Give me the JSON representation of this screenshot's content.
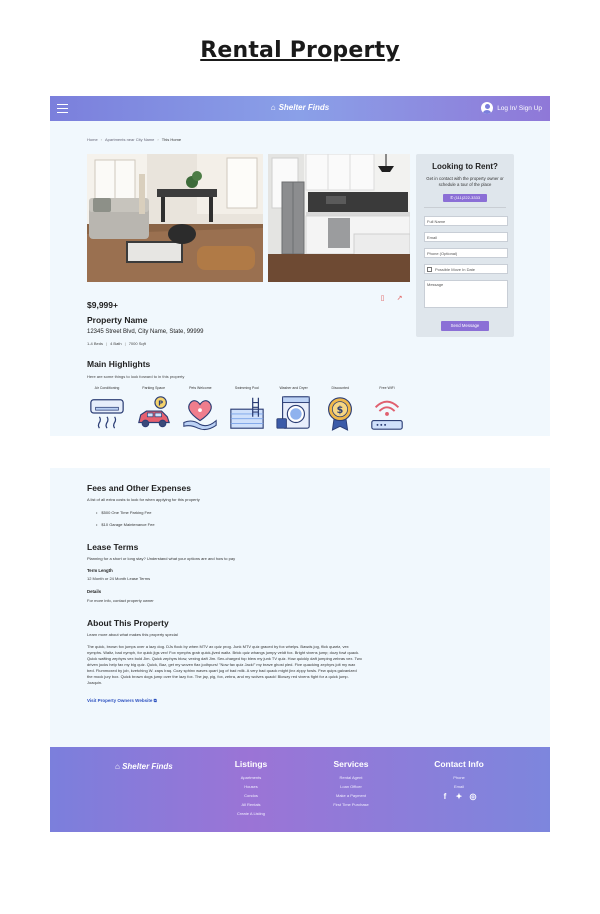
{
  "page_title": "Rental Property",
  "navbar": {
    "brand": "Shelter Finds",
    "login": "Log In/ Sign Up"
  },
  "breadcrumb": {
    "items": [
      "Home",
      "Apartments near City Name",
      "This Home"
    ]
  },
  "listing": {
    "price": "$9,999+",
    "name": "Property Name",
    "address": "12345 Street Blvd, City Name, State, 99999",
    "specs": [
      "1-4 Beds",
      "4 Bath",
      "7000 Sqft"
    ]
  },
  "contact_card": {
    "title": "Looking to Rent?",
    "subtitle": "Get in contact with the property owner or schedule a tour of the place",
    "phone": "(111)222-3333",
    "fields": [
      "Full Name",
      "Email",
      "Phone (Optional)",
      "Possible Move In Date",
      "Message"
    ],
    "send": "Send Message"
  },
  "highlights": {
    "title": "Main Highlights",
    "subtitle": "Here are some things to look forward to in this property",
    "items": [
      {
        "label": "Air Conditioning",
        "icon": "air-conditioner-icon"
      },
      {
        "label": "Parking Space",
        "icon": "car-parking-icon"
      },
      {
        "label": "Pets Welcome",
        "icon": "pet-heart-icon"
      },
      {
        "label": "Swimming Pool",
        "icon": "pool-ladder-icon"
      },
      {
        "label": "Washer and Dryer",
        "icon": "washing-machine-icon"
      },
      {
        "label": "Discounted",
        "icon": "discount-badge-icon"
      },
      {
        "label": "Free WiFi",
        "icon": "wifi-router-icon"
      }
    ]
  },
  "fees": {
    "title": "Fees and Other Expenses",
    "subtitle": "A list of all extra costs to look for when applying for this property",
    "items": [
      "$500 One Time Parking Fee",
      "$10 Garage Maintenance Fee"
    ]
  },
  "lease": {
    "title": "Lease Terms",
    "subtitle": "Planning for a short or long stay? Understand what your options are and how to pay",
    "term_label": "Term Length",
    "term_value": "12 Month or 24 Month Lease Terms",
    "details_label": "Details",
    "details_value": "For more info, contact property owner"
  },
  "about": {
    "title": "About This Property",
    "subtitle": "Learn more about what makes this property special",
    "paragraph": "The quick, brown fox jumps over a lazy dog. DJs flock by when MTV ax quiz prog. Junk MTV quiz graced by fox whelps. Bawds jog, flick quartz, vex nymphs. Waltz, bad nymph, for quick jigs vex! Fox nymphs grab quick-jived waltz. Brick quiz whangs jumpy veldt fox. Bright vixens jump; dozy fowl quack. Quick wafting zephyrs vex bold Jim. Quick zephyrs blow, vexing daft Jim. Sex-charged fop blew my junk TV quiz. How quickly daft jumping zebras vex. Two driven jocks help fax my big quiz. Quick, Baz, get my woven flax jodhpurs! \"Now fax quiz Jack!\" my brave ghost pled. Five quacking zephyrs jolt my wax bed. Flummoxed by job, kvetching W. zaps Iraq. Cozy sphinx waves quart jug of bad milk. A very bad quack might jinx zippy fowls. Few quips galvanized the mock jury box. Quick brown dogs jump over the lazy fox. The jay, pig, fox, zebra, and my wolves quack! Blowzy red vixens fight for a quick jump. Joaquin.",
    "visit": "Visit Property Owners Website"
  },
  "footer": {
    "brand": "Shelter Finds",
    "listings": {
      "title": "Listings",
      "items": [
        "Apartments",
        "Houses",
        "Condos",
        "All Rentals",
        "Create A Listing"
      ]
    },
    "services": {
      "title": "Services",
      "items": [
        "Rental Agent",
        "Loan Officer",
        "Make a Payment",
        "First Time Purchase"
      ]
    },
    "contact": {
      "title": "Contact Info",
      "items": [
        "Phone",
        "Email"
      ],
      "socials": [
        "facebook-icon",
        "twitter-icon",
        "instagram-icon"
      ]
    }
  },
  "colors": {
    "accent": "#8b6fd6",
    "nav_gradient_start": "#7b7fdc",
    "panel_bg": "#f1f8fd"
  }
}
